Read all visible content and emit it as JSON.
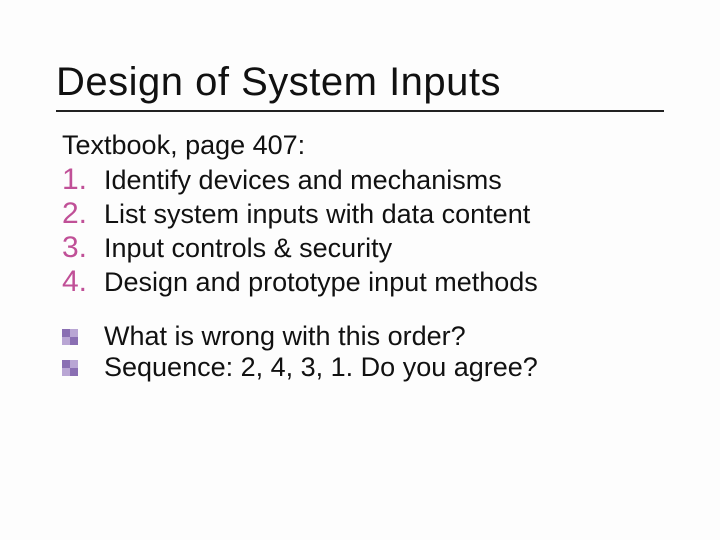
{
  "title": "Design of System Inputs",
  "intro": "Textbook, page 407:",
  "steps": [
    {
      "n": "1.",
      "text": "Identify devices and mechanisms"
    },
    {
      "n": "2.",
      "text": "List system inputs with data content"
    },
    {
      "n": "3.",
      "text": "Input controls & security"
    },
    {
      "n": "4.",
      "text": "Design and prototype input methods"
    }
  ],
  "bullets": [
    "What is wrong with this order?",
    "Sequence: 2, 4, 3, 1. Do you agree?"
  ],
  "colors": {
    "number": "#c05097",
    "bullet": "#7b5fa3"
  }
}
